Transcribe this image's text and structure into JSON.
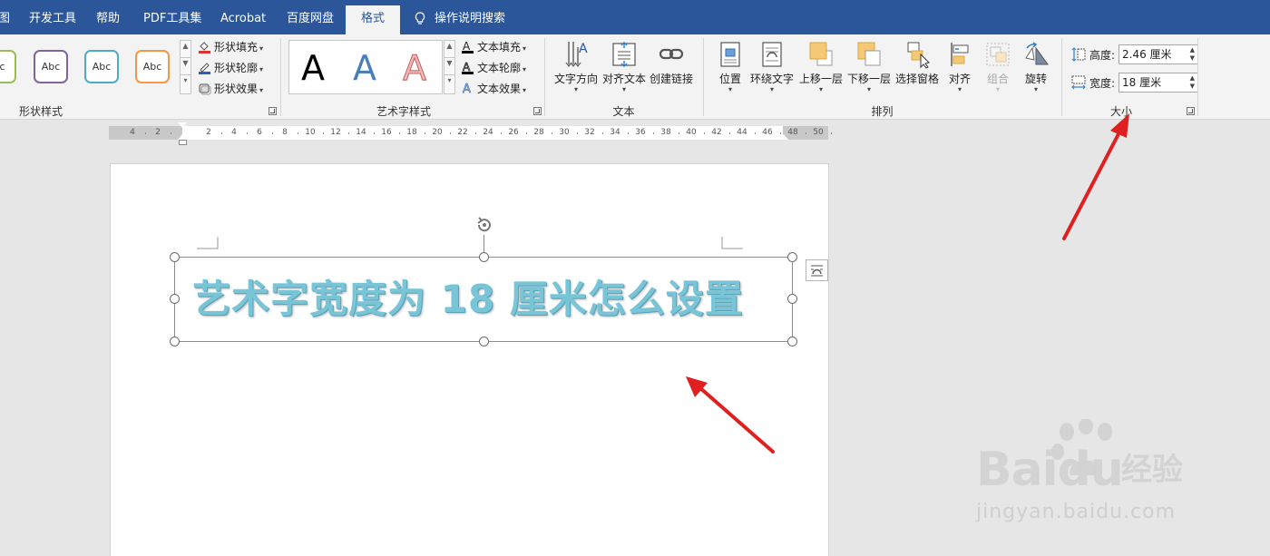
{
  "tabs": [
    {
      "label": "图",
      "active": false
    },
    {
      "label": "开发工具",
      "active": false
    },
    {
      "label": "帮助",
      "active": false
    },
    {
      "label": "PDF工具集",
      "active": false
    },
    {
      "label": "Acrobat",
      "active": false
    },
    {
      "label": "百度网盘",
      "active": false
    },
    {
      "label": "格式",
      "active": true
    },
    {
      "label": "操作说明搜索",
      "active": false
    }
  ],
  "shape_styles": {
    "group_label": "形状样式",
    "presets": [
      {
        "label": "bc",
        "border_color": "#9bbb59"
      },
      {
        "label": "Abc",
        "border_color": "#8064a2"
      },
      {
        "label": "Abc",
        "border_color": "#4bacc6"
      },
      {
        "label": "Abc",
        "border_color": "#f79646"
      }
    ],
    "fill_label": "形状填充",
    "outline_label": "形状轮廓",
    "effect_label": "形状效果"
  },
  "wordart_styles": {
    "group_label": "艺术字样式",
    "presets": [
      {
        "label": "A",
        "color": "#000000"
      },
      {
        "label": "A",
        "color": "#4a7ebb"
      },
      {
        "label": "A",
        "color": "#f2b7b7"
      }
    ],
    "text_fill_label": "文本填充",
    "text_outline_label": "文本轮廓",
    "text_effect_label": "文本效果"
  },
  "text_group": {
    "group_label": "文本",
    "direction_label": "文字方向",
    "align_label": "对齐文本",
    "link_label": "创建链接"
  },
  "arrange": {
    "group_label": "排列",
    "position_label": "位置",
    "wrap_label": "环绕文字",
    "forward_label": "上移一层",
    "backward_label": "下移一层",
    "pane_label": "选择窗格",
    "align_label": "对齐",
    "group_btn_label": "组合",
    "rotate_label": "旋转"
  },
  "size": {
    "group_label": "大小",
    "height_label": "高度:",
    "height_value": "2.46 厘米",
    "width_label": "宽度:",
    "width_value": "18 厘米"
  },
  "ruler": {
    "ticks": [
      "4",
      "2",
      "2",
      "4",
      "6",
      "8",
      "10",
      "12",
      "14",
      "16",
      "18",
      "20",
      "22",
      "24",
      "26",
      "28",
      "30",
      "32",
      "34",
      "36",
      "38",
      "40",
      "42",
      "44",
      "46",
      "48",
      "50"
    ]
  },
  "document": {
    "wordart_text": "艺术字宽度为 18 厘米怎么设置"
  },
  "watermark": {
    "brand": "Baidu",
    "suffix": "经验",
    "url": "jingyan.baidu.com"
  },
  "colors": {
    "tab_bar": "#2b579a",
    "annotation_arrow": "#e02020"
  }
}
